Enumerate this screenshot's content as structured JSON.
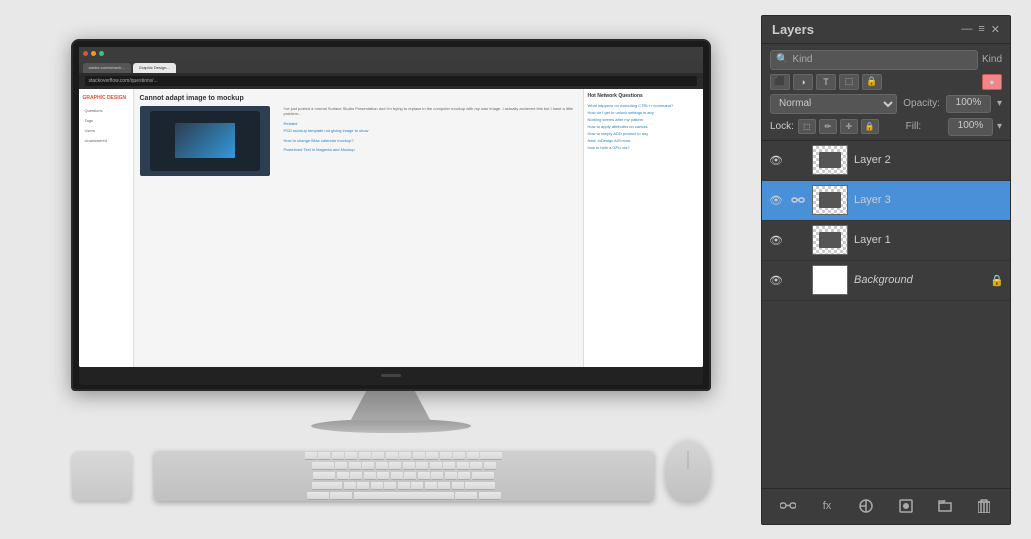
{
  "panel": {
    "title": "Layers",
    "close_icon": "✕",
    "menu_icon": "≡",
    "minimize_icon": "—",
    "filter_label": "Kind",
    "search_placeholder": "Kind",
    "blend_mode": "Normal",
    "opacity_label": "Opacity:",
    "opacity_value": "100%",
    "opacity_arrow": "▾",
    "lock_label": "Lock:",
    "fill_label": "Fill:",
    "fill_value": "100%",
    "fill_arrow": "▾",
    "filter_icons": [
      "⬛",
      "✏",
      "✛",
      "⬚",
      "🔒"
    ],
    "lock_icons": [
      "⬚",
      "✏",
      "✛",
      "🔒"
    ],
    "layers": [
      {
        "name": "Layer 2",
        "visible": true,
        "selected": false,
        "locked": false,
        "thumbnail_type": "checker_monitor"
      },
      {
        "name": "Layer 3",
        "visible": true,
        "selected": true,
        "locked": false,
        "thumbnail_type": "checker_monitor"
      },
      {
        "name": "Layer 1",
        "visible": true,
        "selected": false,
        "locked": false,
        "thumbnail_type": "checker_monitor"
      },
      {
        "name": "Background",
        "visible": true,
        "selected": false,
        "locked": true,
        "thumbnail_type": "white"
      }
    ],
    "footer_icons": [
      "🔗",
      "fx",
      "⬛",
      "🎨",
      "📁",
      "🗑"
    ]
  },
  "browser": {
    "tab1": "adobe.com/search...",
    "tab2": "Graphic Design...",
    "address": "stackoverflow.com/questions/...",
    "title": "Cannot adapt image to mockup",
    "body_text": "I've just posted a normal Surface Studio Presentation and I'm trying to replace in the computer mockup with my own image. I actually achieved this but I have a little problem..."
  },
  "colors": {
    "panel_bg": "#3c3c3c",
    "selected_layer": "#4a90d9",
    "border": "#2a2a2a"
  }
}
